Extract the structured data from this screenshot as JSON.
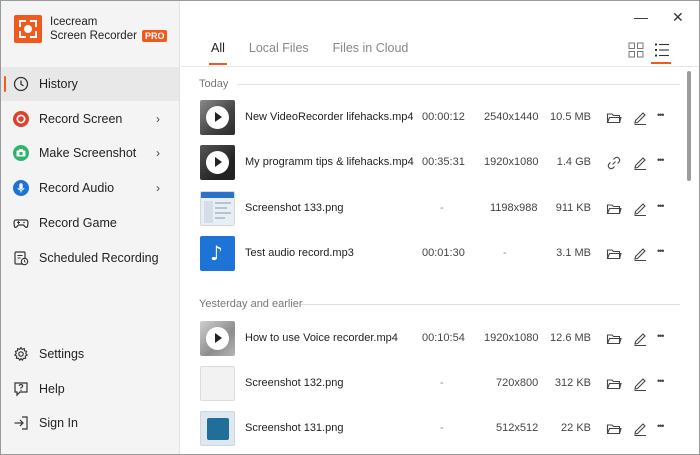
{
  "app": {
    "name_line1": "Icecream",
    "name_line2": "Screen Recorder",
    "badge": "PRO",
    "accent": "#ef5a1f"
  },
  "window_controls": {
    "minimize": "—",
    "close": "✕"
  },
  "sidebar": {
    "items": [
      {
        "label": "History",
        "icon": "clock-icon",
        "active": true
      },
      {
        "label": "Record Screen",
        "icon": "record-icon",
        "submenu": true
      },
      {
        "label": "Make Screenshot",
        "icon": "camera-icon",
        "submenu": true
      },
      {
        "label": "Record Audio",
        "icon": "microphone-icon",
        "submenu": true
      },
      {
        "label": "Record Game",
        "icon": "gamepad-icon"
      },
      {
        "label": "Scheduled Recording",
        "icon": "scheduled-icon"
      }
    ],
    "bottom": [
      {
        "label": "Settings",
        "icon": "gear-icon"
      },
      {
        "label": "Help",
        "icon": "help-icon"
      },
      {
        "label": "Sign In",
        "icon": "sign-in-icon"
      }
    ],
    "chevron": "›"
  },
  "tabs": [
    {
      "label": "All",
      "active": true
    },
    {
      "label": "Local Files"
    },
    {
      "label": "Files in Cloud"
    }
  ],
  "view_modes": [
    "grid-view-icon",
    "list-view-icon"
  ],
  "sections": [
    {
      "title": "Today"
    },
    {
      "title": "Yesterday and earlier"
    }
  ],
  "files": [
    {
      "name": "New VideoRecorder lifehacks.mp4",
      "duration": "00:00:12",
      "resolution": "2540x1440",
      "size": "10.5 MB",
      "type": "video",
      "first_action": "folder-icon"
    },
    {
      "name": "My programm tips & lifehacks.mp4",
      "duration": "00:35:31",
      "resolution": "1920x1080",
      "size": "1.4 GB",
      "type": "video",
      "first_action": "link-icon"
    },
    {
      "name": "Screenshot 133.png",
      "duration": "-",
      "resolution": "1198x988",
      "size": "911 KB",
      "type": "screenshot",
      "first_action": "folder-icon"
    },
    {
      "name": "Test audio record.mp3",
      "duration": "00:01:30",
      "resolution": "-",
      "size": "3.1 MB",
      "type": "audio",
      "first_action": "folder-icon"
    },
    {
      "name": "How to use Voice recorder.mp4",
      "duration": "00:10:54",
      "resolution": "1920x1080",
      "size": "12.6 MB",
      "type": "video",
      "first_action": "folder-icon"
    },
    {
      "name": "Screenshot 132.png",
      "duration": "-",
      "resolution": "720x800",
      "size": "312 KB",
      "type": "screenshot",
      "first_action": "folder-icon"
    },
    {
      "name": "Screenshot 131.png",
      "duration": "-",
      "resolution": "512x512",
      "size": "22 KB",
      "type": "screenshot",
      "first_action": "folder-icon"
    }
  ],
  "more_glyph": "•••",
  "music_glyph": "♪"
}
